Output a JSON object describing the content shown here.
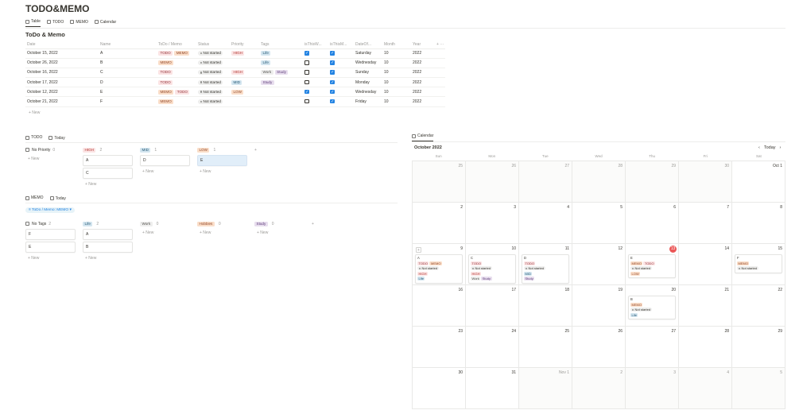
{
  "page": {
    "title": "TODO&MEMO"
  },
  "view_tabs": [
    {
      "label": "Table",
      "active": true
    },
    {
      "label": "TODO",
      "active": false
    },
    {
      "label": "MEMO",
      "active": false
    },
    {
      "label": "Calendar",
      "active": false
    }
  ],
  "db_title": "ToDo & Memo",
  "table": {
    "headers": [
      "Date",
      "Name",
      "ToDo / Memo",
      "Status",
      "Priority",
      "Tags",
      "isThisW...",
      "isThisM...",
      "DateOf...",
      "Month",
      "Year"
    ],
    "add_column": "+",
    "more": "···",
    "rows": [
      {
        "date": "October 15, 2022",
        "name": "A",
        "types": [
          "TODO",
          "MEMO"
        ],
        "status": "Not started",
        "priority": "HIGH",
        "tags": [
          "Life"
        ],
        "w": true,
        "m": true,
        "dow": "Saturday",
        "month": "10",
        "year": "2022"
      },
      {
        "date": "October 26, 2022",
        "name": "B",
        "types": [
          "MEMO"
        ],
        "status": "Not started",
        "priority": "",
        "tags": [
          "Life"
        ],
        "w": false,
        "m": true,
        "dow": "Wednesday",
        "month": "10",
        "year": "2022"
      },
      {
        "date": "October 16, 2022",
        "name": "C",
        "types": [
          "TODO"
        ],
        "status": "Not started",
        "priority": "HIGH",
        "tags": [
          "Work",
          "Study"
        ],
        "w": false,
        "m": true,
        "dow": "Sunday",
        "month": "10",
        "year": "2022"
      },
      {
        "date": "October 17, 2022",
        "name": "D",
        "types": [
          "TODO"
        ],
        "status": "Not started",
        "priority": "MID",
        "tags": [
          "Study"
        ],
        "w": false,
        "m": true,
        "dow": "Monday",
        "month": "10",
        "year": "2022"
      },
      {
        "date": "October 12, 2022",
        "name": "E",
        "types": [
          "MEMO",
          "TODO"
        ],
        "status": "Not started",
        "priority": "LOW",
        "tags": [],
        "w": true,
        "m": true,
        "dow": "Wednesday",
        "month": "10",
        "year": "2022"
      },
      {
        "date": "October 21, 2022",
        "name": "F",
        "types": [
          "MEMO"
        ],
        "status": "Not started",
        "priority": "",
        "tags": [],
        "w": false,
        "m": true,
        "dow": "Friday",
        "month": "10",
        "year": "2022"
      }
    ],
    "new_label": "+ New"
  },
  "todo_board": {
    "tabs": [
      {
        "label": "TODO",
        "active": true
      },
      {
        "label": "Today",
        "active": false
      }
    ],
    "columns": [
      {
        "label": "No Priority",
        "count": "0",
        "cls": "",
        "cards": []
      },
      {
        "label": "HIGH",
        "count": "2",
        "cls": "t-high",
        "cards": [
          "A",
          "C"
        ]
      },
      {
        "label": "MID",
        "count": "1",
        "cls": "t-mid",
        "cards": [
          "D"
        ]
      },
      {
        "label": "LOW",
        "count": "1",
        "cls": "t-low",
        "cards": [
          "E"
        ]
      }
    ],
    "add": "+",
    "new_label": "+ New"
  },
  "memo_board": {
    "tabs": [
      {
        "label": "MEMO",
        "active": true
      },
      {
        "label": "Today",
        "active": false
      }
    ],
    "filter": "ToDo / Memo: MEMO",
    "columns": [
      {
        "label": "No Tags",
        "count": "2",
        "cls": "",
        "cards": [
          "F",
          "E"
        ]
      },
      {
        "label": "Life",
        "count": "2",
        "cls": "t-life",
        "cards": [
          "A",
          "B"
        ]
      },
      {
        "label": "Work",
        "count": "0",
        "cls": "t-work",
        "cards": []
      },
      {
        "label": "Hobbies",
        "count": "0",
        "cls": "t-hobbies",
        "cards": []
      },
      {
        "label": "Study",
        "count": "0",
        "cls": "t-study",
        "cards": []
      }
    ],
    "add": "+",
    "new_label": "+ New"
  },
  "calendar": {
    "tab": "Calendar",
    "month": "October 2022",
    "today_label": "Today",
    "weekdays": [
      "Sun",
      "Mon",
      "Tue",
      "Wed",
      "Thu",
      "Fri",
      "Sat"
    ],
    "days": [
      "25",
      "26",
      "27",
      "28",
      "29",
      "30",
      "Oct 1",
      "2",
      "3",
      "4",
      "5",
      "6",
      "7",
      "8",
      "9",
      "10",
      "11",
      "12",
      "13",
      "14",
      "15",
      "16",
      "17",
      "18",
      "19",
      "20",
      "21",
      "22",
      "23",
      "24",
      "25",
      "26",
      "27",
      "28",
      "29",
      "30",
      "31",
      "Nov 1",
      "2",
      "3",
      "4",
      "5"
    ],
    "today_index": 18,
    "events": {
      "18": {
        "name": "E",
        "tags": [
          [
            "MEMO",
            "t-memo"
          ],
          [
            "TODO",
            "t-todo"
          ]
        ],
        "status": "Not started",
        "extra": [
          [
            "LOW",
            "t-low"
          ]
        ]
      },
      "14": {
        "name": "A",
        "tags": [
          [
            "TODO",
            "t-todo"
          ],
          [
            "MEMO",
            "t-memo"
          ]
        ],
        "status": "Not started",
        "extra": [
          [
            "HIGH",
            "t-high"
          ],
          [
            "Life",
            "t-life"
          ]
        ]
      },
      "15": {
        "name": "C",
        "tags": [
          [
            "TODO",
            "t-todo"
          ]
        ],
        "status": "Not started",
        "extra": [
          [
            "HIGH",
            "t-high"
          ],
          [
            "Work",
            "t-work"
          ],
          [
            "Study",
            "t-study"
          ]
        ]
      },
      "16": {
        "name": "D",
        "tags": [
          [
            "TODO",
            "t-todo"
          ]
        ],
        "status": "Not started",
        "extra": [
          [
            "MID",
            "t-mid"
          ],
          [
            "Study",
            "t-study"
          ]
        ]
      },
      "20": {
        "name": "F",
        "tags": [
          [
            "MEMO",
            "t-memo"
          ]
        ],
        "status": "Not started",
        "extra": []
      },
      "25": {
        "name": "B",
        "tags": [
          [
            "MEMO",
            "t-memo"
          ]
        ],
        "status": "Not started",
        "extra": [
          [
            "Life",
            "t-life"
          ]
        ]
      }
    }
  }
}
